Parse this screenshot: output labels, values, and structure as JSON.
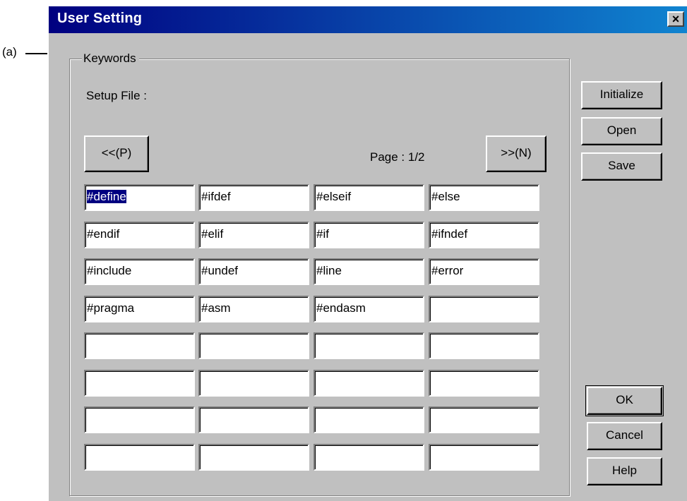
{
  "annotation": {
    "label": "(a)"
  },
  "window": {
    "title": "User Setting",
    "close_symbol": "×"
  },
  "group": {
    "legend": "Keywords",
    "setup_file_label": "Setup File :"
  },
  "paging": {
    "prev_label": "<<(P)",
    "next_label": ">>(N)",
    "page_text": "Page : 1/2"
  },
  "side_buttons": {
    "initialize": "Initialize",
    "open": "Open",
    "save": "Save",
    "ok": "OK",
    "cancel": "Cancel",
    "help": "Help"
  },
  "keywords": [
    [
      "#define",
      "#ifdef",
      "#elseif",
      "#else"
    ],
    [
      "#endif",
      "#elif",
      "#if",
      "#ifndef"
    ],
    [
      "#include",
      "#undef",
      "#line",
      "#error"
    ],
    [
      "#pragma",
      "#asm",
      "#endasm",
      ""
    ],
    [
      "",
      "",
      "",
      ""
    ],
    [
      "",
      "",
      "",
      ""
    ],
    [
      "",
      "",
      "",
      ""
    ],
    [
      "",
      "",
      "",
      ""
    ]
  ],
  "selected_cell": "#define",
  "colors": {
    "titlebar_start": "#000080",
    "titlebar_end": "#1084d0",
    "dialog_bg": "#c0c0c0",
    "selection": "#000080"
  }
}
